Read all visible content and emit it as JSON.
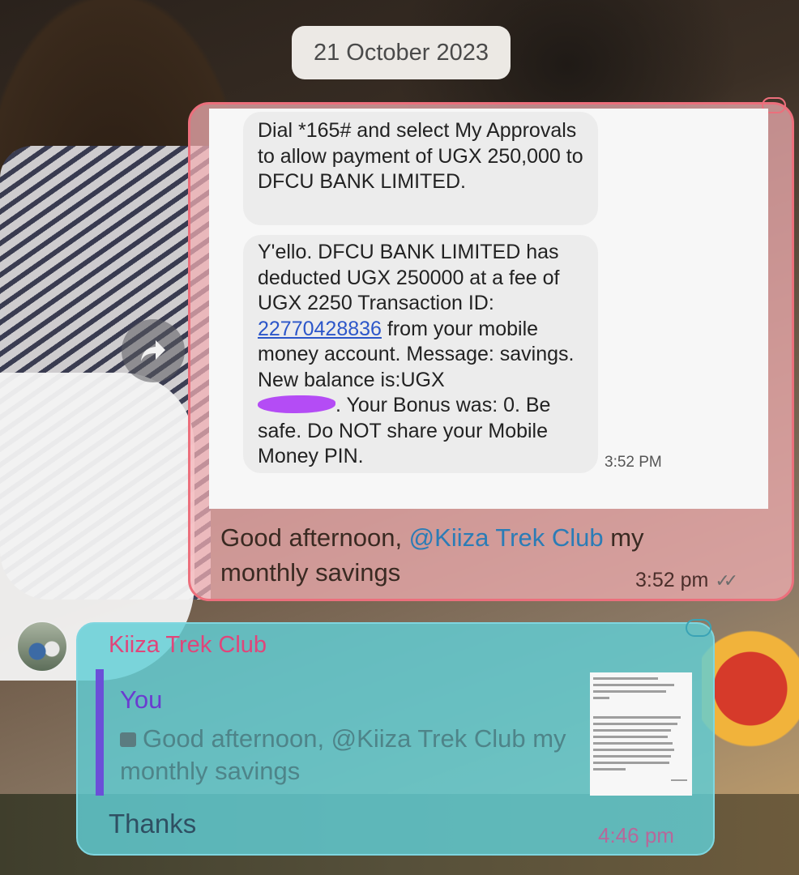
{
  "chat": {
    "date_separator": "21 October 2023",
    "outgoing": {
      "screenshot": {
        "sms1": "Dial *165# and select My Approvals to allow payment of UGX 250,000 to DFCU BANK LIMITED.",
        "sms2_part1": "Y'ello. DFCU BANK LIMITED  has deducted UGX 250000 at a fee of UGX 2250 Transaction ID: ",
        "sms2_link": "22770428836",
        "sms2_part2": " from your mobile money account. Message: savings. New balance is:UGX ",
        "sms2_part3": ". Your Bonus was: 0. Be safe. Do NOT share your Mobile Money PIN.",
        "time": "3:52 PM"
      },
      "caption_before": "Good afternoon,  ",
      "caption_mention": "@Kiiza Trek Club",
      "caption_after": " my monthly savings",
      "time": "3:52 pm"
    },
    "incoming": {
      "sender": "Kiiza Trek Club",
      "quote_author": "You",
      "quote_text": "Good afternoon,  @Kiiza Trek Club my monthly savings",
      "text": "Thanks",
      "time": "4:46 pm"
    }
  },
  "colors": {
    "outgoing_border": "#ec6f7c",
    "incoming_bg": "#60ced6",
    "sender_name": "#e0457a",
    "quote_bar": "#6b4fd8",
    "mention": "#2b7cb6"
  },
  "icons": [
    "forward-icon",
    "image-icon",
    "double-check-icon",
    "avatar"
  ]
}
